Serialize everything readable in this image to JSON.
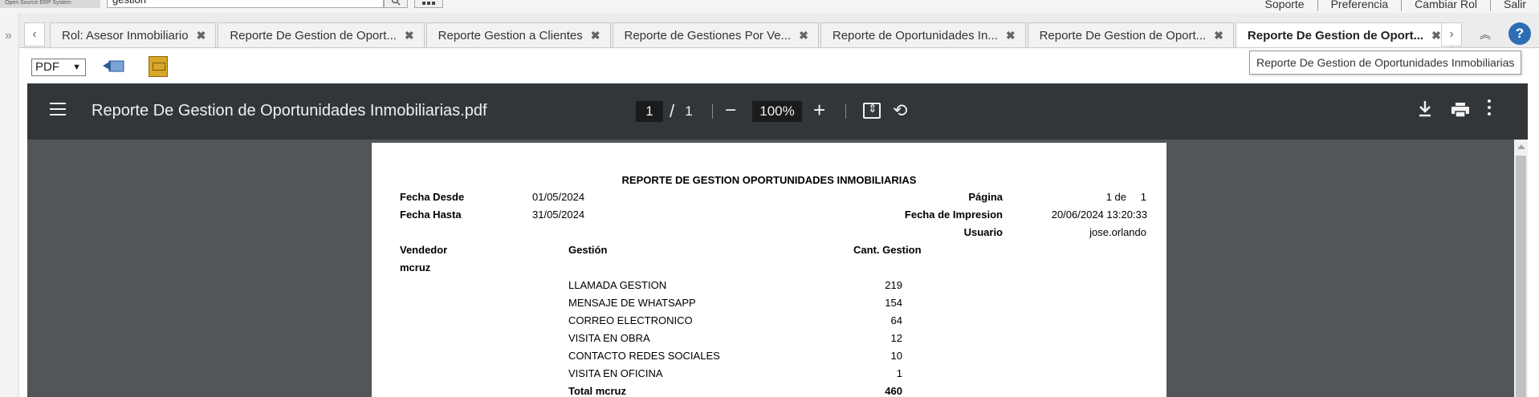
{
  "header": {
    "logo_text": "Open Source ERP System",
    "search_value": "gestion",
    "links": [
      "Soporte",
      "Preferencia",
      "Cambiar Rol",
      "Salir"
    ]
  },
  "tabs": [
    {
      "label": "Rol: Asesor Inmobiliario",
      "active": false
    },
    {
      "label": "Reporte De Gestion de Oport...",
      "active": false
    },
    {
      "label": "Reporte Gestion a Clientes",
      "active": false
    },
    {
      "label": "Reporte de Gestiones Por Ve...",
      "active": false
    },
    {
      "label": "Reporte de Oportunidades In...",
      "active": false
    },
    {
      "label": "Reporte De Gestion de Oport...",
      "active": false
    },
    {
      "label": "Reporte De Gestion de Oport...",
      "active": true
    }
  ],
  "toolbar": {
    "format_value": "PDF",
    "tooltip": "Reporte De Gestion de Oportunidades Inmobiliarias"
  },
  "viewer": {
    "file_name": "Reporte De Gestion de Oportunidades Inmobiliarias.pdf",
    "current_page": "1",
    "page_separator": "/",
    "total_pages": "1",
    "zoom": "100%"
  },
  "report": {
    "title": "REPORTE DE GESTION OPORTUNIDADES INMOBILIARIAS",
    "fecha_desde_label": "Fecha Desde",
    "fecha_desde": "01/05/2024",
    "fecha_hasta_label": "Fecha Hasta",
    "fecha_hasta": "31/05/2024",
    "pagina_label": "Página",
    "pagina_value": "1 de",
    "pagina_total": "1",
    "fecha_impresion_label": "Fecha de Impresion",
    "fecha_impresion": "20/06/2024 13:20:33",
    "usuario_label": "Usuario",
    "usuario": "jose.orlando",
    "col_vendedor": "Vendedor",
    "col_gestion": "Gestión",
    "col_cant": "Cant. Gestion",
    "vendedor": "mcruz",
    "rows": [
      {
        "gestion": "LLAMADA GESTION",
        "cant": "219"
      },
      {
        "gestion": "MENSAJE DE WHATSAPP",
        "cant": "154"
      },
      {
        "gestion": "CORREO ELECTRONICO",
        "cant": "64"
      },
      {
        "gestion": "VISITA EN OBRA",
        "cant": "12"
      },
      {
        "gestion": "CONTACTO REDES SOCIALES",
        "cant": "10"
      },
      {
        "gestion": "VISITA EN OFICINA",
        "cant": "1"
      }
    ],
    "total_label": "Total mcruz",
    "total_value": "460"
  }
}
